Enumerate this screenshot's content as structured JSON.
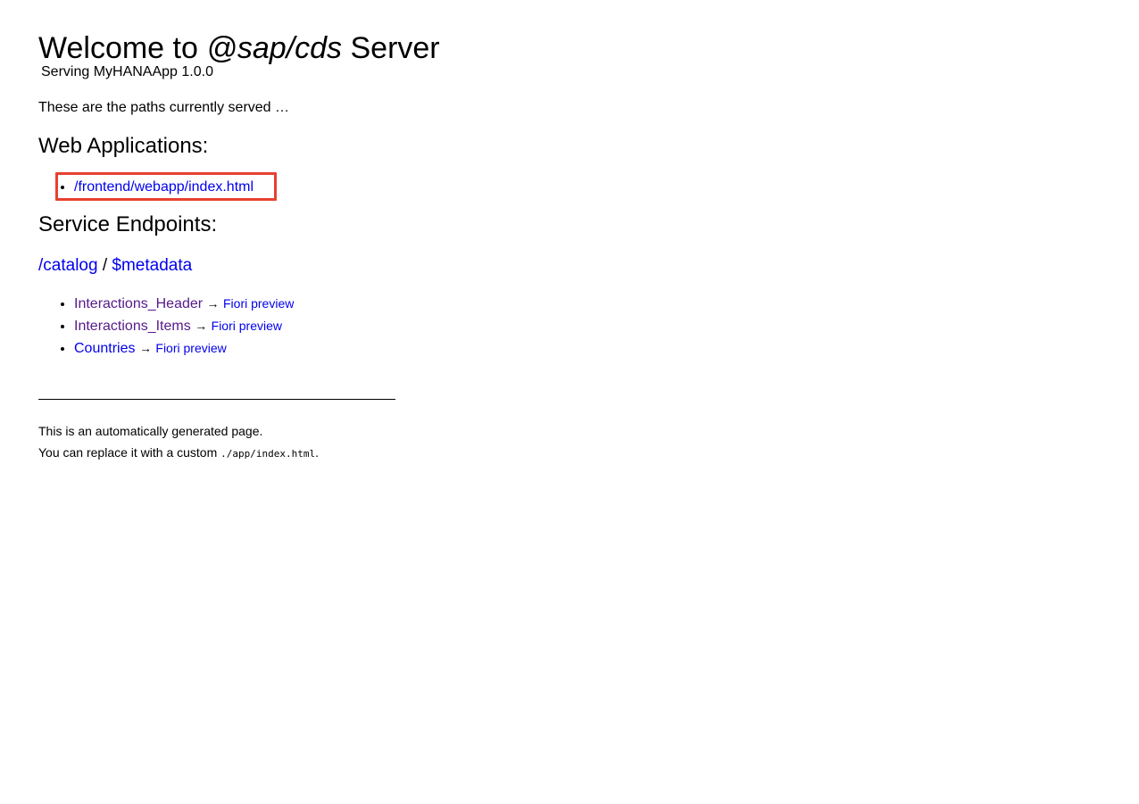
{
  "header": {
    "title_prefix": "Welcome to ",
    "title_emphasis": "@sap/cds",
    "title_suffix": " Server",
    "subtitle": "Serving MyHANAApp 1.0.0"
  },
  "intro": "These are the paths currently served …",
  "web_applications": {
    "heading": "Web Applications:",
    "items": [
      {
        "label": "/frontend/webapp/index.html",
        "highlighted": true
      }
    ]
  },
  "service_endpoints": {
    "heading": "Service Endpoints:",
    "service_path": "/catalog",
    "separator": "/",
    "metadata_label": "$metadata",
    "entities": [
      {
        "name": "Interactions_Header",
        "arrow": "→",
        "preview": "Fiori preview",
        "visited": true
      },
      {
        "name": "Interactions_Items",
        "arrow": "→",
        "preview": "Fiori preview",
        "visited": true
      },
      {
        "name": "Countries",
        "arrow": "→",
        "preview": "Fiori preview",
        "visited": false
      }
    ]
  },
  "footer": {
    "line1": "This is an automatically generated page.",
    "line2_prefix": "You can replace it with a custom ",
    "line2_code": "./app/index.html",
    "line2_suffix": "."
  },
  "colors": {
    "link": "#0000ee",
    "visited": "#551a8b",
    "highlight": "#e8402f"
  }
}
